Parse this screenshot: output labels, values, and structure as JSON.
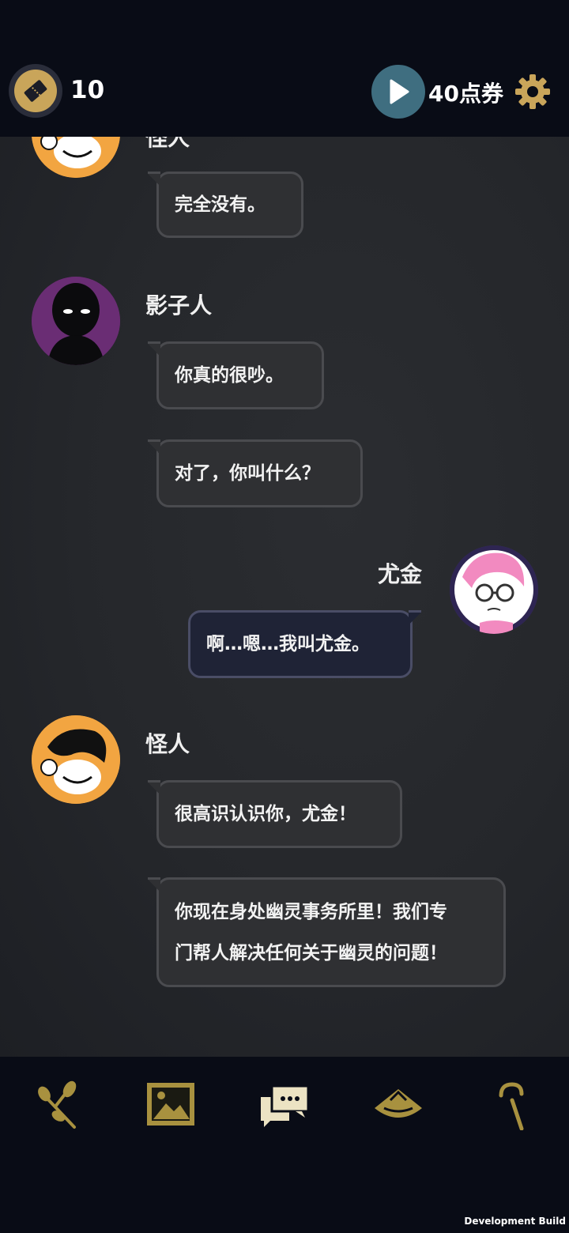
{
  "header": {
    "ticket_count": "10",
    "points_label": "40点券"
  },
  "messages": [
    {
      "speaker": "怪人",
      "text": "完全没有。"
    },
    {
      "speaker": "影子人",
      "texts": [
        "你真的很吵。",
        "对了，你叫什么？"
      ]
    },
    {
      "speaker": "尤金",
      "text": "啊…嗯…我叫尤金。"
    },
    {
      "speaker": "怪人",
      "texts": [
        "很高识认识你，尤金！",
        "你现在身处幽灵事务所里！我们专",
        "门帮人解决任何关于幽灵的问题！"
      ]
    }
  ],
  "nav": {
    "items": [
      "branch-icon",
      "gallery-icon",
      "chat-icon",
      "hat-icon",
      "cane-icon"
    ]
  },
  "footer": {
    "dev_build": "Development Build"
  },
  "colors": {
    "accent_gold": "#c9a55a",
    "play_blue": "#3f6e80",
    "bubble_bg": "#2f3033",
    "user_bubble_bg": "#1f2336"
  }
}
